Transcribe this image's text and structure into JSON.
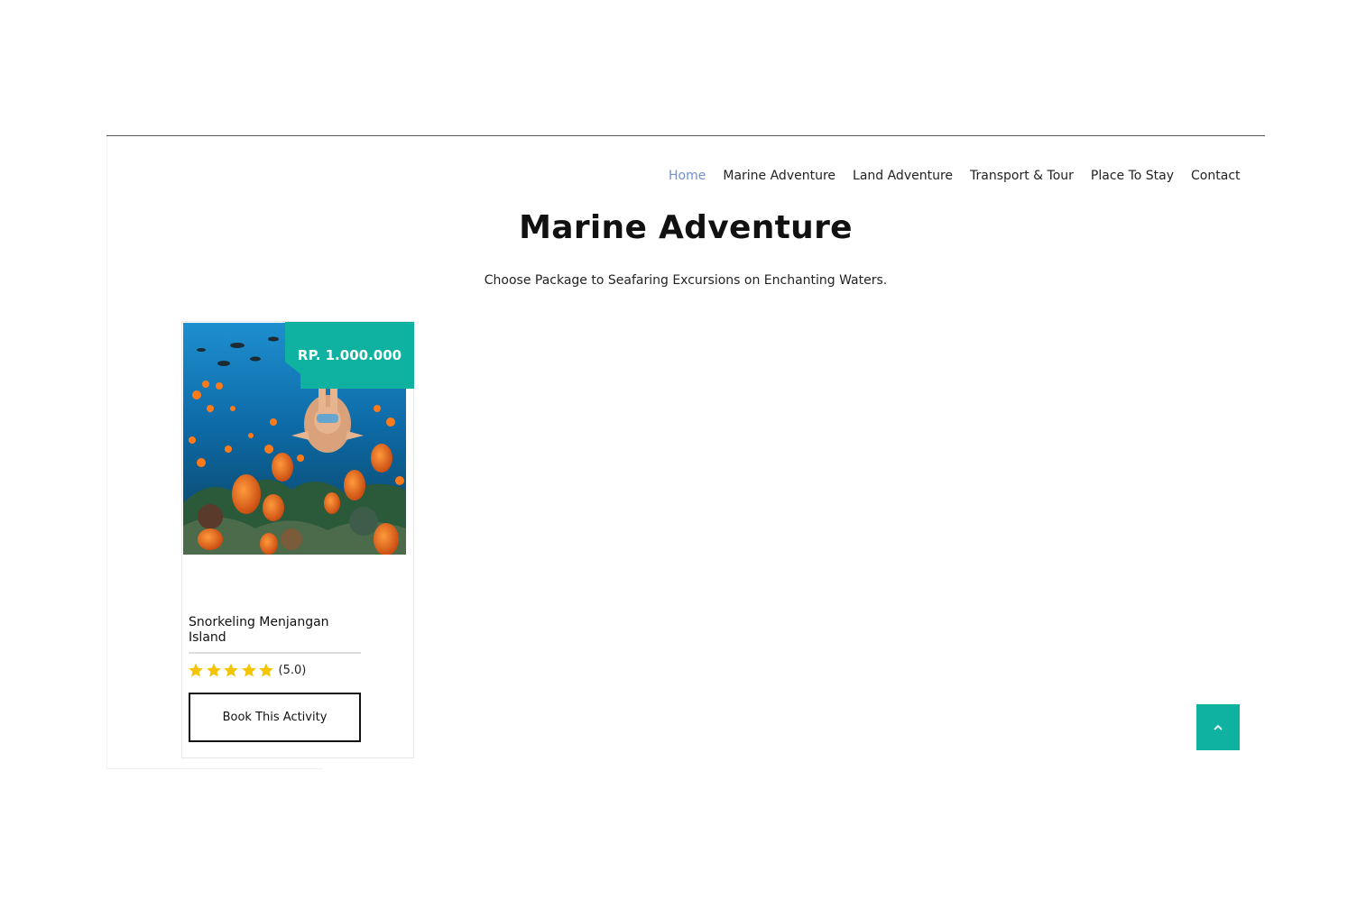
{
  "nav": {
    "items": [
      {
        "label": "Home",
        "active": true
      },
      {
        "label": "Marine Adventure",
        "active": false
      },
      {
        "label": "Land Adventure",
        "active": false
      },
      {
        "label": "Transport & Tour",
        "active": false
      },
      {
        "label": "Place To Stay",
        "active": false
      },
      {
        "label": "Contact",
        "active": false
      }
    ]
  },
  "page": {
    "title": "Marine Adventure",
    "subtitle": "Choose Package to Seafaring Excursions on Enchanting Waters."
  },
  "card": {
    "price": "RP. 1.000.000",
    "title": "Snorkeling Menjangan Island",
    "rating": 5,
    "rating_text": "(5.0)",
    "button_label": "Book This Activity",
    "image_icon": "snorkeling-photo"
  },
  "scroll_top": {
    "icon": "chevron-up-icon"
  },
  "colors": {
    "accent": "#0fb2a0",
    "nav_active": "#6f8fd6",
    "star": "#f5c400"
  }
}
